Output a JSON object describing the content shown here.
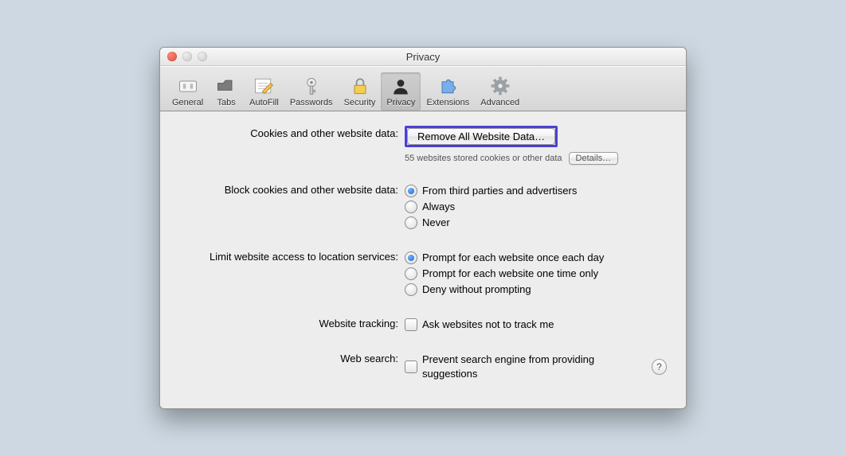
{
  "window": {
    "title": "Privacy"
  },
  "toolbar": {
    "items": [
      {
        "label": "General"
      },
      {
        "label": "Tabs"
      },
      {
        "label": "AutoFill"
      },
      {
        "label": "Passwords"
      },
      {
        "label": "Security"
      },
      {
        "label": "Privacy"
      },
      {
        "label": "Extensions"
      },
      {
        "label": "Advanced"
      }
    ],
    "selected_index": 5
  },
  "sections": {
    "cookies": {
      "label": "Cookies and other website data:",
      "remove_button": "Remove All Website Data…",
      "stored_text": "55 websites stored cookies or other data",
      "details_button": "Details…"
    },
    "block": {
      "label": "Block cookies and other website data:",
      "options": [
        "From third parties and advertisers",
        "Always",
        "Never"
      ],
      "selected": 0
    },
    "location": {
      "label": "Limit website access to location services:",
      "options": [
        "Prompt for each website once each day",
        "Prompt for each website one time only",
        "Deny without prompting"
      ],
      "selected": 0
    },
    "tracking": {
      "label": "Website tracking:",
      "checkbox": "Ask websites not to track me"
    },
    "websearch": {
      "label": "Web search:",
      "checkbox": "Prevent search engine from providing suggestions"
    }
  },
  "help_glyph": "?"
}
